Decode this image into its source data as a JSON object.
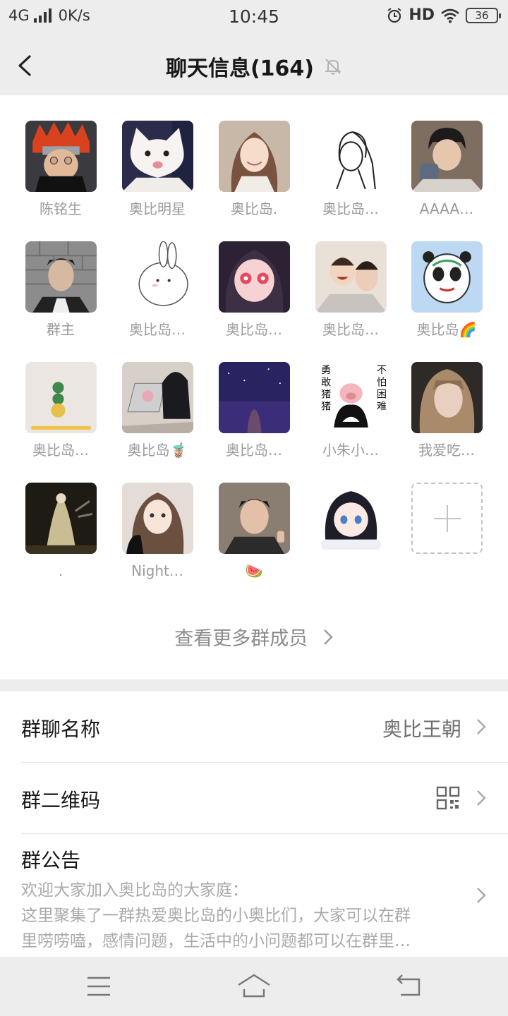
{
  "status_bar": {
    "network": "4G",
    "speed": "0K/s",
    "time": "10:45",
    "hd": "HD",
    "battery": "36"
  },
  "header": {
    "title": "聊天信息(164)"
  },
  "members": [
    {
      "name": "陈铭生",
      "avatar": "red-hair-masked-ninja"
    },
    {
      "name": "奥比明星",
      "avatar": "white-cat"
    },
    {
      "name": "奥比岛.",
      "avatar": "smiling-girl"
    },
    {
      "name": "奥比岛…",
      "avatar": "line-drawing-girl"
    },
    {
      "name": "AAAA…",
      "avatar": "boy-with-can"
    },
    {
      "name": "群主",
      "avatar": "man-portrait"
    },
    {
      "name": "奥比岛…",
      "avatar": "white-rabbit"
    },
    {
      "name": "奥比岛…",
      "avatar": "anime-girl-pink-eyes"
    },
    {
      "name": "奥比岛…",
      "avatar": "laughing-couple"
    },
    {
      "name": "奥比岛🌈",
      "avatar": "panda-mascot"
    },
    {
      "name": "奥比岛…",
      "avatar": "stacked-balls"
    },
    {
      "name": "奥比岛🧋",
      "avatar": "laptop-plush"
    },
    {
      "name": "奥比岛…",
      "avatar": "starry-sky-girl"
    },
    {
      "name": "小朱小…",
      "avatar": "pig-sticker"
    },
    {
      "name": "我爱吃…",
      "avatar": "blonde-girl"
    },
    {
      "name": ".",
      "avatar": "dark-fantasy-figure"
    },
    {
      "name": "Night…",
      "avatar": "girl-with-plush"
    },
    {
      "name": "🍉",
      "avatar": "young-man-portrait"
    },
    {
      "name": "",
      "avatar": "anime-girl-blue-eyes"
    }
  ],
  "pig_sticker_text": {
    "left": "勇敢猪猪",
    "right": "不怕困难"
  },
  "more_members_label": "查看更多群成员",
  "settings": {
    "group_name_label": "群聊名称",
    "group_name_value": "奥比王朝",
    "qr_label": "群二维码",
    "notice_label": "群公告",
    "notice_lines": [
      "欢迎大家加入奥比岛的大家庭：",
      "这里聚集了一群热爱奥比岛的小奥比们，大家可以在群",
      "里唠唠嗑，感情问题，生活中的小问题都可以在群里…"
    ]
  },
  "colors": {
    "background": "#ededed",
    "card": "#ffffff",
    "muted_text": "#9a9a9a"
  }
}
